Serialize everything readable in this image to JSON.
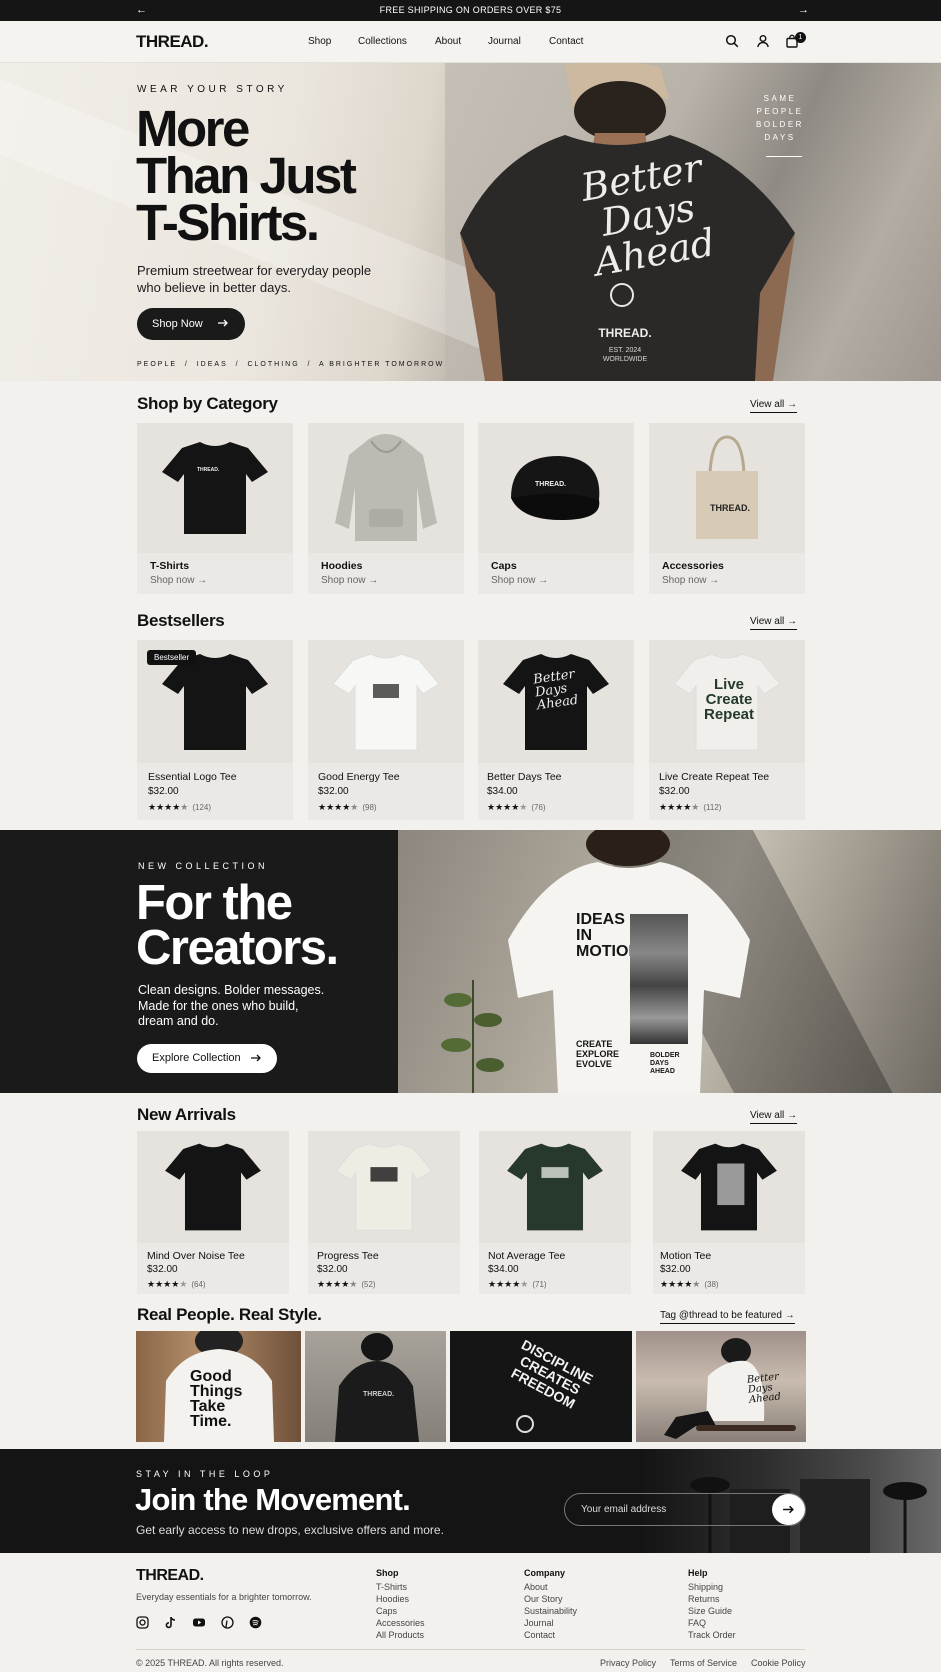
{
  "topbar": {
    "message": "FREE SHIPPING ON ORDERS OVER $75",
    "prev": "←",
    "next": "→"
  },
  "header": {
    "logo": "THREAD.",
    "nav": [
      "Shop",
      "Collections",
      "About",
      "Journal",
      "Contact"
    ],
    "cart_count": "1",
    "icons": [
      "search-icon",
      "user-icon",
      "cart-icon"
    ]
  },
  "hero": {
    "eyebrow": "WEAR YOUR STORY",
    "title_lines": [
      "More",
      "Than Just",
      "T-Shirts."
    ],
    "subtitle_lines": [
      "Premium streetwear for everyday people",
      "who believe in better days."
    ],
    "cta": "Shop Now",
    "tagline": "PEOPLE  /  IDEAS  /  CLOTHING  /  A BRIGHTER TOMORROW",
    "side_text": [
      "SAME",
      "PEOPLE",
      "BOLDER",
      "DAYS"
    ],
    "shirt_print": [
      "Better",
      "Days",
      "Ahead"
    ],
    "shirt_brand": "THREAD.",
    "shirt_est": "EST. 2024",
    "shirt_worldwide": "WORLDWIDE"
  },
  "categories": {
    "title": "Shop by Category",
    "view_all": "View all",
    "items": [
      {
        "name": "T-Shirts",
        "cta": "Shop now"
      },
      {
        "name": "Hoodies",
        "cta": "Shop now"
      },
      {
        "name": "Caps",
        "cta": "Shop now"
      },
      {
        "name": "Accessories",
        "cta": "Shop now"
      }
    ],
    "item_print": "THREAD."
  },
  "bestsellers": {
    "title": "Bestsellers",
    "view_all": "View all",
    "badge": "Bestseller",
    "items": [
      {
        "name": "Essential Logo Tee",
        "price": "$32.00",
        "rating": 4.5,
        "reviews": "(124)"
      },
      {
        "name": "Good Energy Tee",
        "price": "$32.00",
        "rating": 4.5,
        "reviews": "(98)"
      },
      {
        "name": "Better Days Tee",
        "price": "$34.00",
        "rating": 4,
        "reviews": "(76)"
      },
      {
        "name": "Live Create Repeat Tee",
        "price": "$32.00",
        "rating": 4.5,
        "reviews": "(112)"
      }
    ]
  },
  "collection": {
    "eyebrow": "NEW COLLECTION",
    "title_lines": [
      "For the",
      "Creators."
    ],
    "text_lines": [
      "Clean designs. Bolder messages.",
      "Made for the ones who build,",
      "dream and do."
    ],
    "cta": "Explore Collection",
    "shirt_print_top": [
      "IDEAS",
      "IN",
      "MOTION"
    ],
    "shirt_print_bottom": [
      "CREATE",
      "EXPLORE",
      "EVOLVE"
    ],
    "shirt_print_side": [
      "BOLDER",
      "DAYS",
      "AHEAD"
    ]
  },
  "new_arrivals": {
    "title": "New Arrivals",
    "view_all": "View all",
    "items": [
      {
        "name": "Mind Over Noise Tee",
        "price": "$32.00",
        "rating": 4,
        "reviews": "(64)"
      },
      {
        "name": "Progress Tee",
        "price": "$32.00",
        "rating": 4.5,
        "reviews": "(52)"
      },
      {
        "name": "Not Average Tee",
        "price": "$34.00",
        "rating": 4,
        "reviews": "(71)"
      },
      {
        "name": "Motion Tee",
        "price": "$32.00",
        "rating": 4.5,
        "reviews": "(38)"
      }
    ]
  },
  "real_people": {
    "title": "Real People. Real Style.",
    "tag_cta": "Tag @thread to be featured",
    "prints": [
      [
        "Good",
        "Things",
        "Take",
        "Time."
      ],
      [
        "THREAD."
      ],
      [
        "DISCIPLINE",
        "CREATES",
        "FREEDOM"
      ],
      [
        "Better",
        "Days",
        "Ahead"
      ]
    ]
  },
  "newsletter": {
    "eyebrow": "STAY IN THE LOOP",
    "title": "Join the Movement.",
    "text": "Get early access to new drops, exclusive offers and more.",
    "placeholder": "Your email address"
  },
  "footer": {
    "logo": "THREAD.",
    "tagline": "Everyday essentials for a brighter tomorrow.",
    "social_icons": [
      "instagram-icon",
      "tiktok-icon",
      "youtube-icon",
      "pinterest-icon",
      "spotify-icon"
    ],
    "columns": [
      {
        "title": "Shop",
        "links": [
          "T-Shirts",
          "Hoodies",
          "Caps",
          "Accessories",
          "All Products"
        ]
      },
      {
        "title": "Company",
        "links": [
          "About",
          "Our Story",
          "Sustainability",
          "Journal",
          "Contact"
        ]
      },
      {
        "title": "Help",
        "links": [
          "Shipping",
          "Returns",
          "Size Guide",
          "FAQ",
          "Track Order"
        ]
      }
    ],
    "copyright": "© 2025 THREAD. All rights reserved.",
    "legal": [
      "Privacy Policy",
      "Terms of Service",
      "Cookie Policy"
    ]
  },
  "colors": {
    "dark": "#151515",
    "background": "#f2f1ed",
    "card": "#e6e3de",
    "green_tee": "#27392c"
  }
}
